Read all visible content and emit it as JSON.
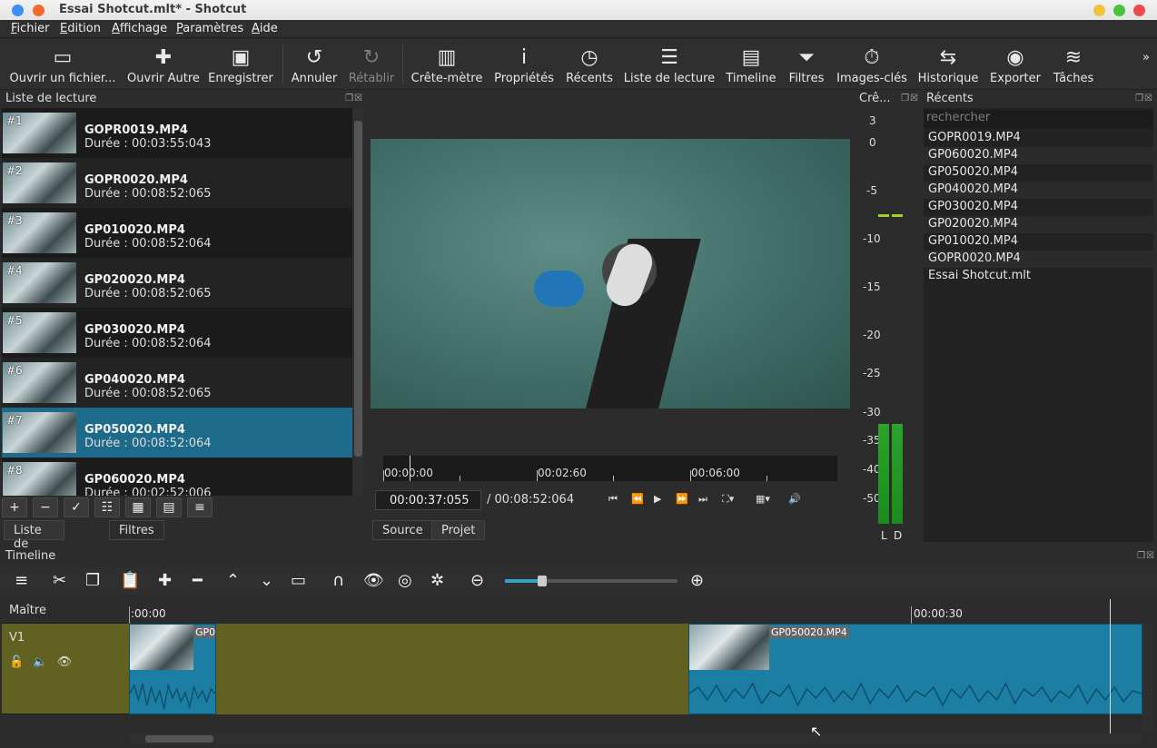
{
  "window": {
    "title": "Essai Shotcut.mlt* - Shotcut"
  },
  "menu": [
    "Fichier",
    "Edition",
    "Affichage",
    "Paramètres",
    "Aide"
  ],
  "toolbar": [
    {
      "label": "Ouvrir un fichier...",
      "icon": "open-file-icon"
    },
    {
      "label": "Ouvrir Autre",
      "icon": "open-other-icon"
    },
    {
      "label": "Enregistrer",
      "icon": "save-icon"
    },
    {
      "label": "Annuler",
      "icon": "undo-icon"
    },
    {
      "label": "Rétablir",
      "icon": "redo-icon"
    },
    {
      "label": "Crête-mètre",
      "icon": "peak-meter-icon"
    },
    {
      "label": "Propriétés",
      "icon": "info-icon"
    },
    {
      "label": "Récents",
      "icon": "clock-icon"
    },
    {
      "label": "Liste de lecture",
      "icon": "list-icon"
    },
    {
      "label": "Timeline",
      "icon": "timeline-icon"
    },
    {
      "label": "Filtres",
      "icon": "filter-icon"
    },
    {
      "label": "Images-clés",
      "icon": "stopwatch-icon"
    },
    {
      "label": "Historique",
      "icon": "history-icon"
    },
    {
      "label": "Exporter",
      "icon": "disc-icon"
    },
    {
      "label": "Tâches",
      "icon": "stack-icon"
    }
  ],
  "playlist": {
    "title": "Liste de lecture",
    "items": [
      {
        "num": "#1",
        "name": "GOPR0019.MP4",
        "duration": "Durée : 00:03:55:043"
      },
      {
        "num": "#2",
        "name": "GOPR0020.MP4",
        "duration": "Durée : 00:08:52:065"
      },
      {
        "num": "#3",
        "name": "GP010020.MP4",
        "duration": "Durée : 00:08:52:064"
      },
      {
        "num": "#4",
        "name": "GP020020.MP4",
        "duration": "Durée : 00:08:52:065"
      },
      {
        "num": "#5",
        "name": "GP030020.MP4",
        "duration": "Durée : 00:08:52:064"
      },
      {
        "num": "#6",
        "name": "GP040020.MP4",
        "duration": "Durée : 00:08:52:065"
      },
      {
        "num": "#7",
        "name": "GP050020.MP4",
        "duration": "Durée : 00:08:52:064"
      },
      {
        "num": "#8",
        "name": "GP060020.MP4",
        "duration": "Durée : 00:02:52:006"
      }
    ],
    "tabs": [
      "Liste de lecture",
      "Filtres"
    ]
  },
  "player": {
    "ruler": [
      "00:00:00",
      "00:02:60",
      "00:06:00"
    ],
    "current_time": "00:00:37:055",
    "total_time": "/ 00:08:52:064",
    "tabs": [
      "Source",
      "Projet"
    ]
  },
  "meter": {
    "title": "Crê...",
    "scale": [
      "3",
      "0",
      "-5",
      "-10",
      "-15",
      "-20",
      "-25",
      "-30",
      "-35",
      "-40",
      "-50"
    ],
    "channels": [
      "L",
      "D"
    ]
  },
  "recents": {
    "title": "Récents",
    "search_placeholder": "rechercher",
    "items": [
      "GOPR0019.MP4",
      "GP060020.MP4",
      "GP050020.MP4",
      "GP040020.MP4",
      "GP030020.MP4",
      "GP020020.MP4",
      "GP010020.MP4",
      "GOPR0020.MP4",
      "Essai Shotcut.mlt"
    ]
  },
  "timeline": {
    "title": "Timeline",
    "master": "Maître",
    "track": "V1",
    "ruler": [
      ":00:00",
      "00:00:30"
    ],
    "clips": [
      {
        "name": "GP0"
      },
      {
        "name": "GP050020.MP4"
      }
    ]
  }
}
